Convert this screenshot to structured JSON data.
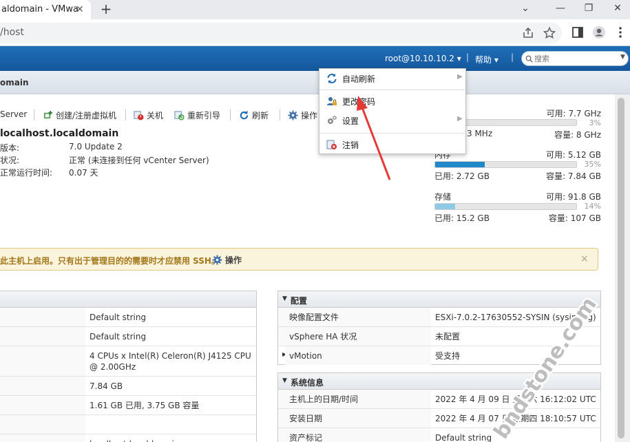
{
  "browser": {
    "tab_title": "aldomain - VMwa",
    "tab_close": "✕",
    "new_tab": "+",
    "url": "/host",
    "window_min": "—",
    "window_restore": "❐",
    "window_close": "✕"
  },
  "header": {
    "user": "root@10.10.10.2 ▾",
    "sep": "|",
    "help": "帮助 ▾",
    "search_placeholder": "搜索"
  },
  "title": "omain",
  "actions": [
    {
      "label": "Server"
    },
    {
      "label": "创建/注册虚拟机"
    },
    {
      "label": "关机"
    },
    {
      "label": "重新引导"
    },
    {
      "label": "刷新"
    },
    {
      "label": "操作"
    }
  ],
  "host": {
    "name": "localhost.localdomain",
    "rows": [
      {
        "key": "版本:",
        "value": "7.0 Update 2"
      },
      {
        "key": "状况:",
        "value": "正常 (未连接到任何 vCenter Server)"
      },
      {
        "key": "正常运行时间:",
        "value": "0.07 天"
      }
    ]
  },
  "resources": {
    "cpu": {
      "free": "可用: 7.7 GHz",
      "pct": "3%",
      "used": "3 MHz",
      "capacity": "容量: 8 GHz",
      "fraction": 0.03
    },
    "memory": {
      "label": "内存",
      "free": "可用: 5.12 GB",
      "pct": "35%",
      "used": "已用: 2.72 GB",
      "capacity": "容量: 7.84 GB",
      "fraction": 0.35
    },
    "storage": {
      "label": "存储",
      "free": "可用: 91.8 GB",
      "pct": "14%",
      "used": "已用: 15.2 GB",
      "capacity": "容量: 107 GB",
      "fraction": 0.14
    }
  },
  "warning": {
    "text": "此主机上启用。只有出于管理目的的需要时才应禁用 SSH。",
    "action": "操作",
    "close": "×"
  },
  "hardware_values": [
    "Default string",
    "Default string",
    "4 CPUs x Intel(R) Celeron(R) J4125 CPU @ 2.00GHz",
    "7.84 GB",
    "1.61 GB 已用, 3.75 GB 容量",
    "",
    "localhost.localdomain"
  ],
  "config": {
    "title": "配置",
    "rows": [
      {
        "key": "映像配置文件",
        "value": "ESXi-7.0.2-17630552-SYSIN (sysin.org)"
      },
      {
        "key": "vSphere HA 状况",
        "value": "未配置"
      },
      {
        "key": "vMotion",
        "value": "受支持"
      }
    ]
  },
  "sysinfo": {
    "title": "系统信息",
    "rows": [
      {
        "key": "主机上的日期/时间",
        "value": "2022 年 4 月 09 日 星期六 16:12:02 UTC"
      },
      {
        "key": "安装日期",
        "value": "2022 年 4 月 07 日 星期四 18:10:57 UTC"
      },
      {
        "key": "资产标记",
        "value": "Default string"
      }
    ]
  },
  "dropdown": {
    "items": [
      {
        "label": "自动刷新",
        "arrow": "▶"
      },
      {
        "label": "更改密码"
      },
      {
        "label": "设置",
        "arrow": "▶"
      },
      {
        "label": "注销"
      }
    ]
  },
  "watermark": "bndstone.com",
  "colors": {
    "accent": "#1a6bb3",
    "bar_memory": "#1e88c8",
    "bar_storage": "#8ecae6",
    "warning_bg": "#fbf4dd",
    "arrow": "#e53935"
  }
}
